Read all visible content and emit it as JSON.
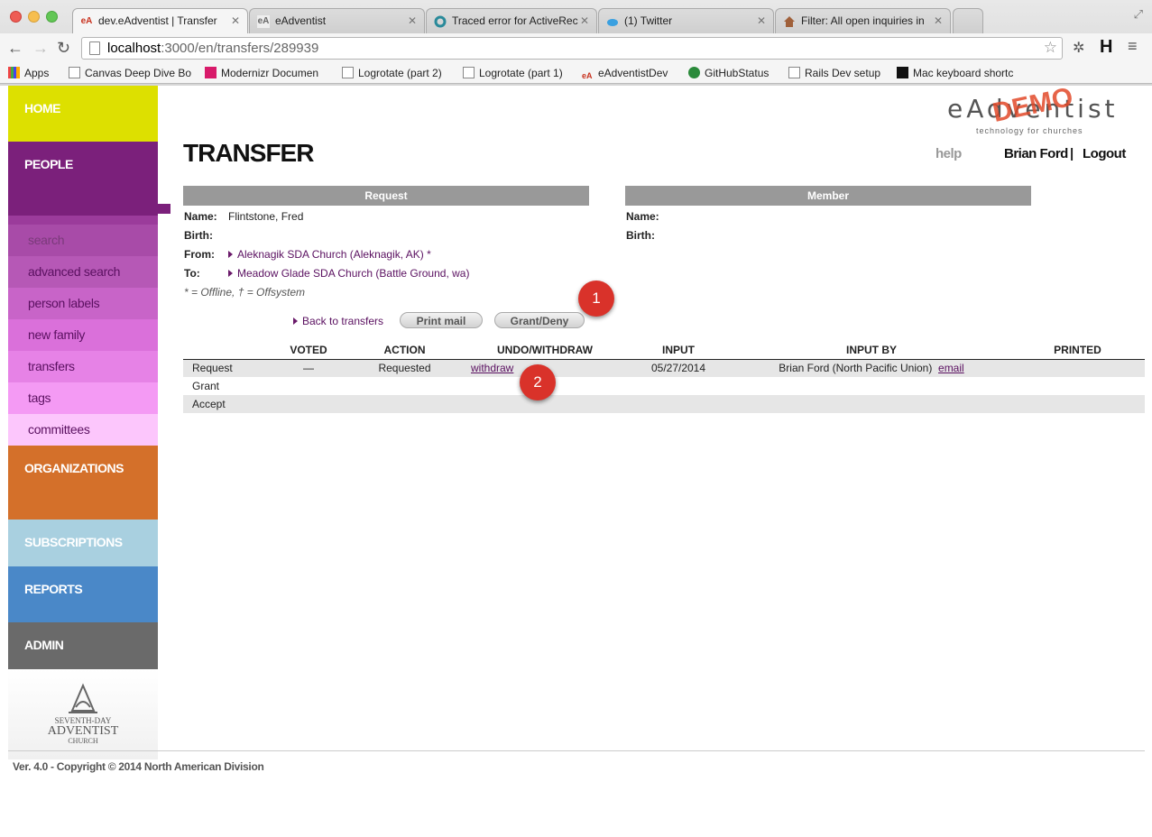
{
  "browser": {
    "tabs": [
      {
        "label": "dev.eAdventist | Transfer",
        "icon": "eA",
        "active": true
      },
      {
        "label": "eAdventist",
        "icon": "eA",
        "active": false
      },
      {
        "label": "Traced error for ActiveRec",
        "icon": "circle-icon",
        "active": false
      },
      {
        "label": "(1) Twitter",
        "icon": "twitter-icon",
        "active": false
      },
      {
        "label": "Filter: All open inquiries in",
        "icon": "house-icon",
        "active": false
      }
    ],
    "url_host": "localhost",
    "url_path": ":3000/en/transfers/289939",
    "bookmarks": [
      "Apps",
      "Canvas Deep Dive Bo",
      "Modernizr Documen",
      "Logrotate (part 2)",
      "Logrotate (part 1)",
      "eAdventistDev",
      "GitHubStatus",
      "Rails Dev setup",
      "Mac keyboard shortc"
    ],
    "toolbar_h": "H"
  },
  "sidebar": {
    "home": "HOME",
    "people": "PEOPLE",
    "people_items": [
      "search",
      "advanced search",
      "person labels",
      "new family",
      "transfers",
      "tags",
      "committees"
    ],
    "organizations": "ORGANIZATIONS",
    "subscriptions": "SUBSCRIPTIONS",
    "reports": "REPORTS",
    "admin": "ADMIN",
    "logo_line1": "SEVENTH-DAY",
    "logo_line2": "ADVENTIST",
    "logo_line3": "CHURCH",
    "colors": {
      "home": "#dde000",
      "people": "#7b207b",
      "organizations": "#d4702a",
      "subscriptions": "#a9d0e0",
      "reports": "#4a88c8",
      "admin": "#6a6a6a"
    }
  },
  "header": {
    "logo_text": "eAdventist",
    "logo_demo": "DEMO",
    "logo_tagline": "technology for churches",
    "page_title": "TRANSFER",
    "help": "help",
    "user": "Brian Ford",
    "separator": "|",
    "logout": "Logout"
  },
  "request": {
    "header": "Request",
    "name_label": "Name:",
    "name": "Flintstone, Fred",
    "birth_label": "Birth:",
    "from_label": "From:",
    "from": "Aleknagik SDA Church (Aleknagik, AK) *",
    "to_label": "To:",
    "to": "Meadow Glade SDA Church (Battle Ground, wa)",
    "legend": "* = Offline, † = Offsystem"
  },
  "member": {
    "header": "Member",
    "name_label": "Name:",
    "birth_label": "Birth:"
  },
  "actions": {
    "back": "Back to transfers",
    "print": "Print mail",
    "grant": "Grant/Deny",
    "badge1": "1",
    "badge2": "2"
  },
  "table": {
    "columns": [
      "",
      "VOTED",
      "ACTION",
      "UNDO/WITHDRAW",
      "INPUT",
      "INPUT BY",
      "PRINTED"
    ],
    "rows": [
      {
        "step": "Request",
        "voted": "—",
        "action": "Requested",
        "undo": "withdraw",
        "input": "05/27/2014",
        "input_by": "Brian Ford (North Pacific Union)",
        "email": "email",
        "printed": ""
      },
      {
        "step": "Grant",
        "voted": "",
        "action": "",
        "undo": "",
        "input": "",
        "input_by": "",
        "email": "",
        "printed": ""
      },
      {
        "step": "Accept",
        "voted": "",
        "action": "",
        "undo": "",
        "input": "",
        "input_by": "",
        "email": "",
        "printed": ""
      }
    ]
  },
  "footer": "Ver. 4.0 - Copyright © 2014 North American Division"
}
